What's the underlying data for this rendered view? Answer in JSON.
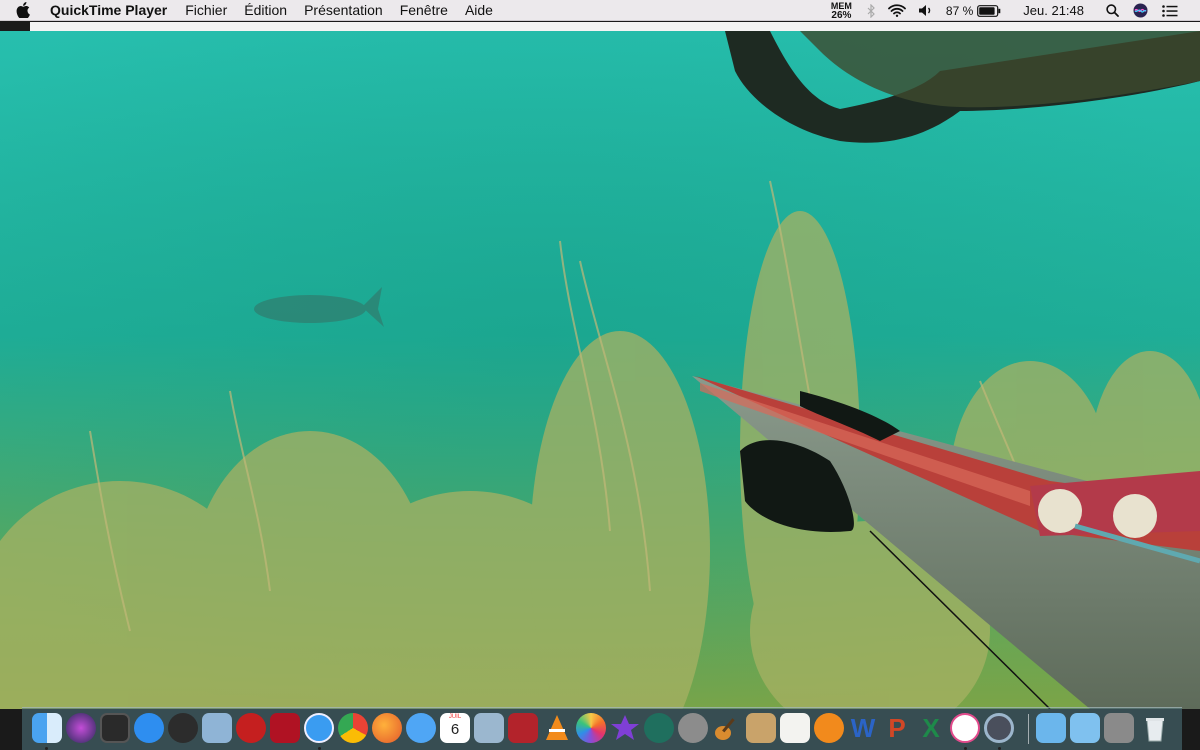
{
  "menubar": {
    "app_name": "QuickTime Player",
    "menus": [
      "Fichier",
      "Édition",
      "Présentation",
      "Fenêtre",
      "Aide"
    ],
    "mem_label": "MEM",
    "mem_value": "26%",
    "battery": "87 %",
    "clock": "Jeu. 21:48"
  },
  "dock": {
    "calendar_day": "6",
    "calendar_month": "JUIL"
  },
  "colors": {
    "menubar_bg": "#ece9ec",
    "water": "#1fb3a2",
    "speargun_band": "#c0392b"
  }
}
